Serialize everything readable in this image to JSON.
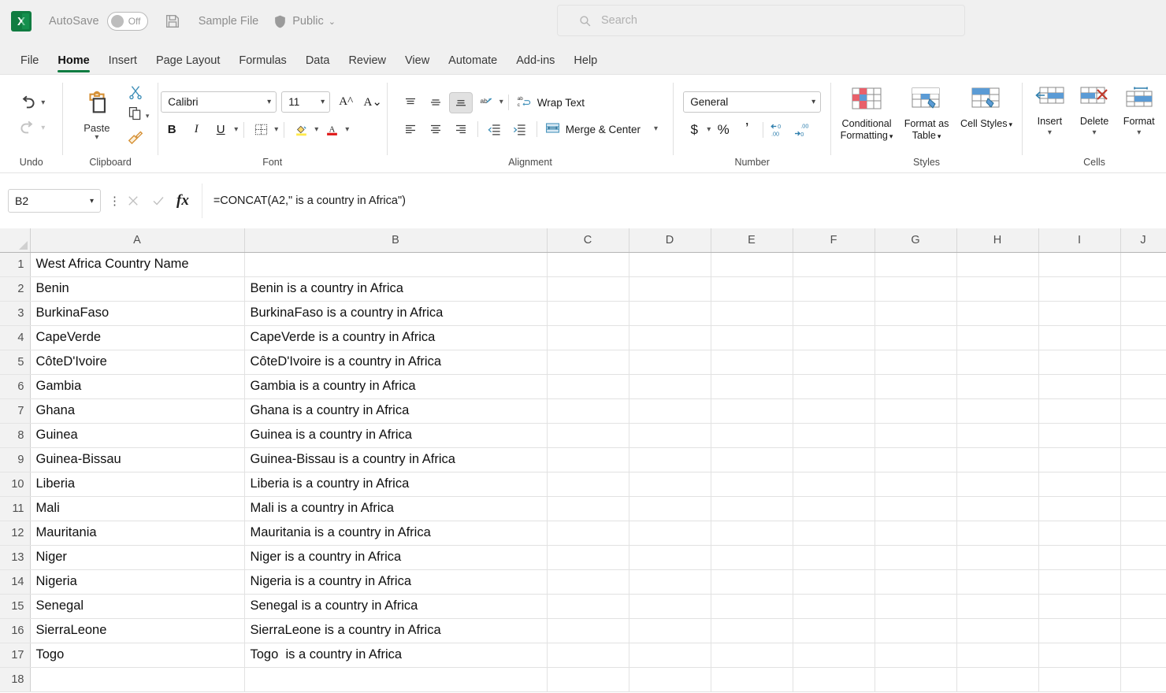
{
  "titlebar": {
    "app_logo": "excel-logo",
    "logo_letter": "X",
    "autosave_label": "AutoSave",
    "autosave_state": "Off",
    "file_name": "Sample File",
    "sensitivity_label": "Public",
    "caret": "⌄"
  },
  "search": {
    "placeholder": "Search"
  },
  "tabs": [
    {
      "label": "File",
      "active": false
    },
    {
      "label": "Home",
      "active": true
    },
    {
      "label": "Insert",
      "active": false
    },
    {
      "label": "Page Layout",
      "active": false
    },
    {
      "label": "Formulas",
      "active": false
    },
    {
      "label": "Data",
      "active": false
    },
    {
      "label": "Review",
      "active": false
    },
    {
      "label": "View",
      "active": false
    },
    {
      "label": "Automate",
      "active": false
    },
    {
      "label": "Add-ins",
      "active": false
    },
    {
      "label": "Help",
      "active": false
    }
  ],
  "ribbon": {
    "groups": {
      "undo": {
        "label": "Undo"
      },
      "clipboard": {
        "label": "Clipboard",
        "paste_label": "Paste"
      },
      "font": {
        "label": "Font",
        "font_family": "Calibri",
        "font_size": "11",
        "bold": "B",
        "italic": "I",
        "underline": "U"
      },
      "alignment": {
        "label": "Alignment",
        "wrap_text": "Wrap Text",
        "merge_center": "Merge & Center"
      },
      "number": {
        "label": "Number",
        "format": "General",
        "currency": "$",
        "percent": "%",
        "comma": "ʔ"
      },
      "styles": {
        "label": "Styles",
        "conditional_formatting": "Conditional Formatting",
        "format_as_table": "Format as Table",
        "cell_styles": "Cell Styles"
      },
      "cells": {
        "label": "Cells",
        "insert": "Insert",
        "delete": "Delete",
        "format": "Format"
      }
    }
  },
  "formula_bar": {
    "name_box": "B2",
    "formula": "=CONCAT(A2,\" is a country in Africa\")"
  },
  "grid": {
    "column_headers": [
      "A",
      "B",
      "C",
      "D",
      "E",
      "F",
      "G",
      "H",
      "I",
      "J"
    ],
    "row_numbers": [
      "1",
      "2",
      "3",
      "4",
      "5",
      "6",
      "7",
      "8",
      "9",
      "10",
      "11",
      "12",
      "13",
      "14",
      "15",
      "16",
      "17",
      "18"
    ],
    "rows": [
      {
        "n": "1",
        "a": "West Africa Country Name",
        "b": ""
      },
      {
        "n": "2",
        "a": "Benin",
        "b": "Benin is a country in Africa"
      },
      {
        "n": "3",
        "a": "BurkinaFaso",
        "b": "BurkinaFaso is a country in Africa"
      },
      {
        "n": "4",
        "a": "CapeVerde",
        "b": "CapeVerde is a country in Africa"
      },
      {
        "n": "5",
        "a": "CôteD'Ivoire",
        "b": "CôteD'Ivoire is a country in Africa"
      },
      {
        "n": "6",
        "a": "Gambia",
        "b": "Gambia is a country in Africa"
      },
      {
        "n": "7",
        "a": "Ghana",
        "b": "Ghana is a country in Africa"
      },
      {
        "n": "8",
        "a": "Guinea",
        "b": "Guinea is a country in Africa"
      },
      {
        "n": "9",
        "a": "Guinea-Bissau",
        "b": "Guinea-Bissau is a country in Africa"
      },
      {
        "n": "10",
        "a": "Liberia",
        "b": "Liberia is a country in Africa"
      },
      {
        "n": "11",
        "a": "Mali",
        "b": "Mali is a country in Africa"
      },
      {
        "n": "12",
        "a": "Mauritania",
        "b": "Mauritania is a country in Africa"
      },
      {
        "n": "13",
        "a": "Niger",
        "b": "Niger is a country in Africa"
      },
      {
        "n": "14",
        "a": "Nigeria",
        "b": "Nigeria is a country in Africa"
      },
      {
        "n": "15",
        "a": "Senegal",
        "b": "Senegal is a country in Africa"
      },
      {
        "n": "16",
        "a": "SierraLeone",
        "b": "SierraLeone is a country in Africa"
      },
      {
        "n": "17",
        "a": "Togo",
        "b": "Togo  is a country in Africa"
      },
      {
        "n": "18",
        "a": "",
        "b": ""
      }
    ]
  },
  "colors": {
    "accent_green": "#107c41",
    "ribbon_bg": "#f0f0f0",
    "grid_line": "#e2e2e2",
    "header_bg": "#f2f2f2"
  }
}
